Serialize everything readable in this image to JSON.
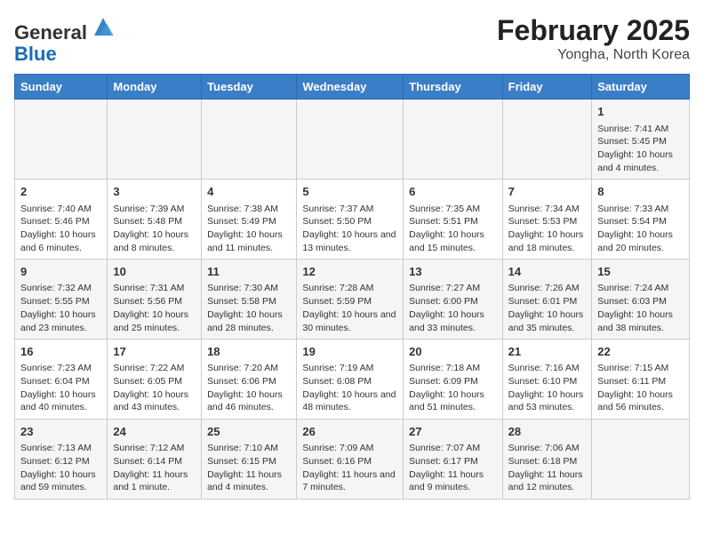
{
  "logo": {
    "general": "General",
    "blue": "Blue"
  },
  "title": "February 2025",
  "subtitle": "Yongha, North Korea",
  "days_of_week": [
    "Sunday",
    "Monday",
    "Tuesday",
    "Wednesday",
    "Thursday",
    "Friday",
    "Saturday"
  ],
  "weeks": [
    [
      {
        "day": "",
        "info": ""
      },
      {
        "day": "",
        "info": ""
      },
      {
        "day": "",
        "info": ""
      },
      {
        "day": "",
        "info": ""
      },
      {
        "day": "",
        "info": ""
      },
      {
        "day": "",
        "info": ""
      },
      {
        "day": "1",
        "info": "Sunrise: 7:41 AM\nSunset: 5:45 PM\nDaylight: 10 hours and 4 minutes."
      }
    ],
    [
      {
        "day": "2",
        "info": "Sunrise: 7:40 AM\nSunset: 5:46 PM\nDaylight: 10 hours and 6 minutes."
      },
      {
        "day": "3",
        "info": "Sunrise: 7:39 AM\nSunset: 5:48 PM\nDaylight: 10 hours and 8 minutes."
      },
      {
        "day": "4",
        "info": "Sunrise: 7:38 AM\nSunset: 5:49 PM\nDaylight: 10 hours and 11 minutes."
      },
      {
        "day": "5",
        "info": "Sunrise: 7:37 AM\nSunset: 5:50 PM\nDaylight: 10 hours and 13 minutes."
      },
      {
        "day": "6",
        "info": "Sunrise: 7:35 AM\nSunset: 5:51 PM\nDaylight: 10 hours and 15 minutes."
      },
      {
        "day": "7",
        "info": "Sunrise: 7:34 AM\nSunset: 5:53 PM\nDaylight: 10 hours and 18 minutes."
      },
      {
        "day": "8",
        "info": "Sunrise: 7:33 AM\nSunset: 5:54 PM\nDaylight: 10 hours and 20 minutes."
      }
    ],
    [
      {
        "day": "9",
        "info": "Sunrise: 7:32 AM\nSunset: 5:55 PM\nDaylight: 10 hours and 23 minutes."
      },
      {
        "day": "10",
        "info": "Sunrise: 7:31 AM\nSunset: 5:56 PM\nDaylight: 10 hours and 25 minutes."
      },
      {
        "day": "11",
        "info": "Sunrise: 7:30 AM\nSunset: 5:58 PM\nDaylight: 10 hours and 28 minutes."
      },
      {
        "day": "12",
        "info": "Sunrise: 7:28 AM\nSunset: 5:59 PM\nDaylight: 10 hours and 30 minutes."
      },
      {
        "day": "13",
        "info": "Sunrise: 7:27 AM\nSunset: 6:00 PM\nDaylight: 10 hours and 33 minutes."
      },
      {
        "day": "14",
        "info": "Sunrise: 7:26 AM\nSunset: 6:01 PM\nDaylight: 10 hours and 35 minutes."
      },
      {
        "day": "15",
        "info": "Sunrise: 7:24 AM\nSunset: 6:03 PM\nDaylight: 10 hours and 38 minutes."
      }
    ],
    [
      {
        "day": "16",
        "info": "Sunrise: 7:23 AM\nSunset: 6:04 PM\nDaylight: 10 hours and 40 minutes."
      },
      {
        "day": "17",
        "info": "Sunrise: 7:22 AM\nSunset: 6:05 PM\nDaylight: 10 hours and 43 minutes."
      },
      {
        "day": "18",
        "info": "Sunrise: 7:20 AM\nSunset: 6:06 PM\nDaylight: 10 hours and 46 minutes."
      },
      {
        "day": "19",
        "info": "Sunrise: 7:19 AM\nSunset: 6:08 PM\nDaylight: 10 hours and 48 minutes."
      },
      {
        "day": "20",
        "info": "Sunrise: 7:18 AM\nSunset: 6:09 PM\nDaylight: 10 hours and 51 minutes."
      },
      {
        "day": "21",
        "info": "Sunrise: 7:16 AM\nSunset: 6:10 PM\nDaylight: 10 hours and 53 minutes."
      },
      {
        "day": "22",
        "info": "Sunrise: 7:15 AM\nSunset: 6:11 PM\nDaylight: 10 hours and 56 minutes."
      }
    ],
    [
      {
        "day": "23",
        "info": "Sunrise: 7:13 AM\nSunset: 6:12 PM\nDaylight: 10 hours and 59 minutes."
      },
      {
        "day": "24",
        "info": "Sunrise: 7:12 AM\nSunset: 6:14 PM\nDaylight: 11 hours and 1 minute."
      },
      {
        "day": "25",
        "info": "Sunrise: 7:10 AM\nSunset: 6:15 PM\nDaylight: 11 hours and 4 minutes."
      },
      {
        "day": "26",
        "info": "Sunrise: 7:09 AM\nSunset: 6:16 PM\nDaylight: 11 hours and 7 minutes."
      },
      {
        "day": "27",
        "info": "Sunrise: 7:07 AM\nSunset: 6:17 PM\nDaylight: 11 hours and 9 minutes."
      },
      {
        "day": "28",
        "info": "Sunrise: 7:06 AM\nSunset: 6:18 PM\nDaylight: 11 hours and 12 minutes."
      },
      {
        "day": "",
        "info": ""
      }
    ]
  ]
}
